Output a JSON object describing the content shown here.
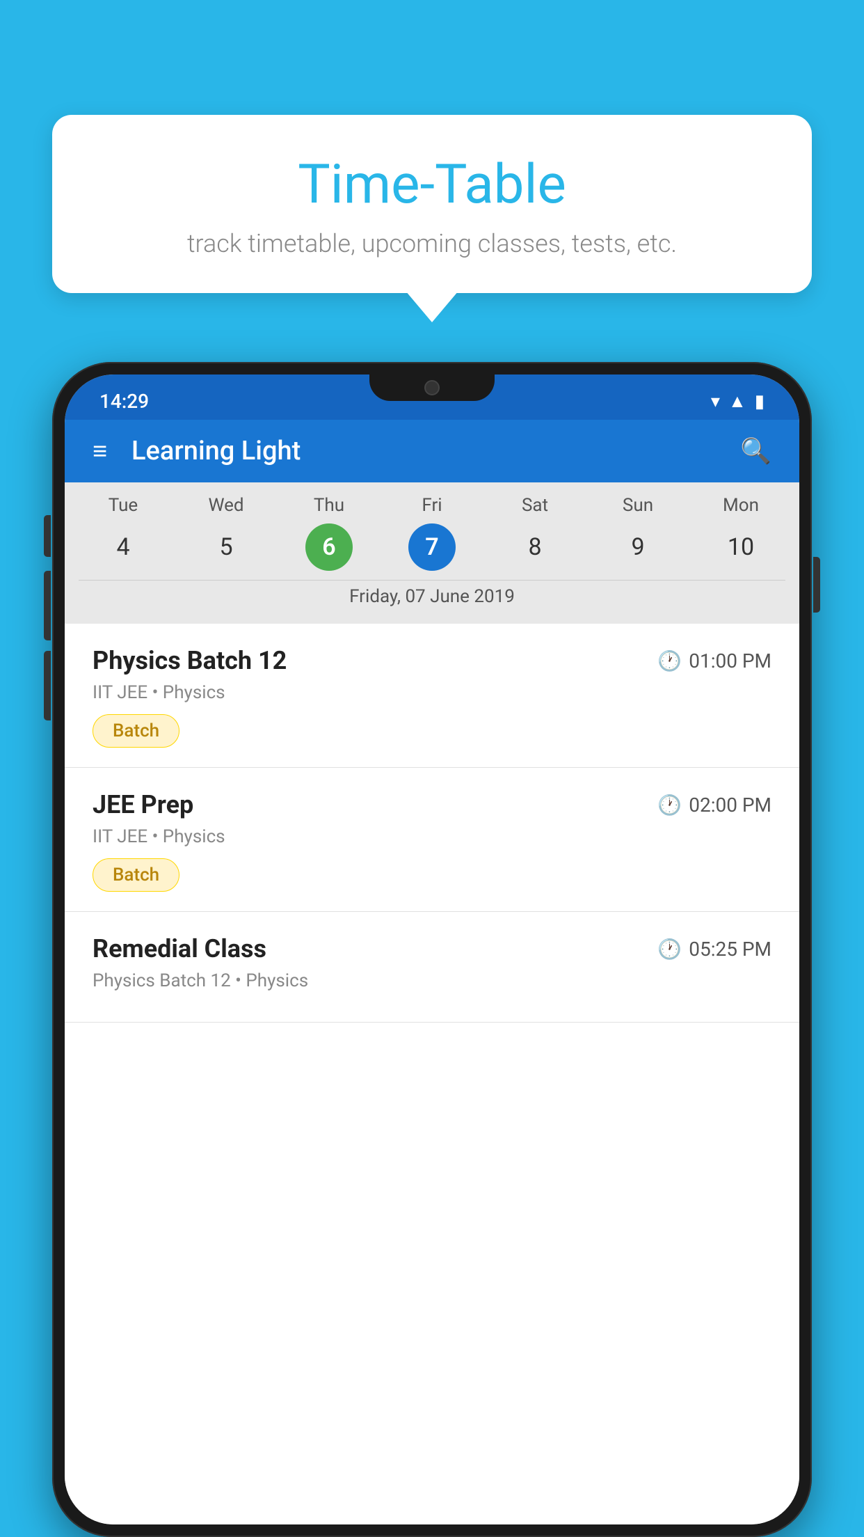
{
  "background_color": "#29B6E8",
  "tooltip": {
    "title": "Time-Table",
    "subtitle": "track timetable, upcoming classes, tests, etc."
  },
  "phone": {
    "status_bar": {
      "time": "14:29"
    },
    "app_bar": {
      "title": "Learning Light"
    },
    "calendar": {
      "days": [
        "Tue",
        "Wed",
        "Thu",
        "Fri",
        "Sat",
        "Sun",
        "Mon"
      ],
      "numbers": [
        "4",
        "5",
        "6",
        "7",
        "8",
        "9",
        "10"
      ],
      "today_index": 2,
      "selected_index": 3,
      "selected_date_label": "Friday, 07 June 2019"
    },
    "classes": [
      {
        "name": "Physics Batch 12",
        "time": "01:00 PM",
        "meta": "IIT JEE • Physics",
        "badge": "Batch"
      },
      {
        "name": "JEE Prep",
        "time": "02:00 PM",
        "meta": "IIT JEE • Physics",
        "badge": "Batch"
      },
      {
        "name": "Remedial Class",
        "time": "05:25 PM",
        "meta": "Physics Batch 12 • Physics",
        "badge": ""
      }
    ]
  }
}
